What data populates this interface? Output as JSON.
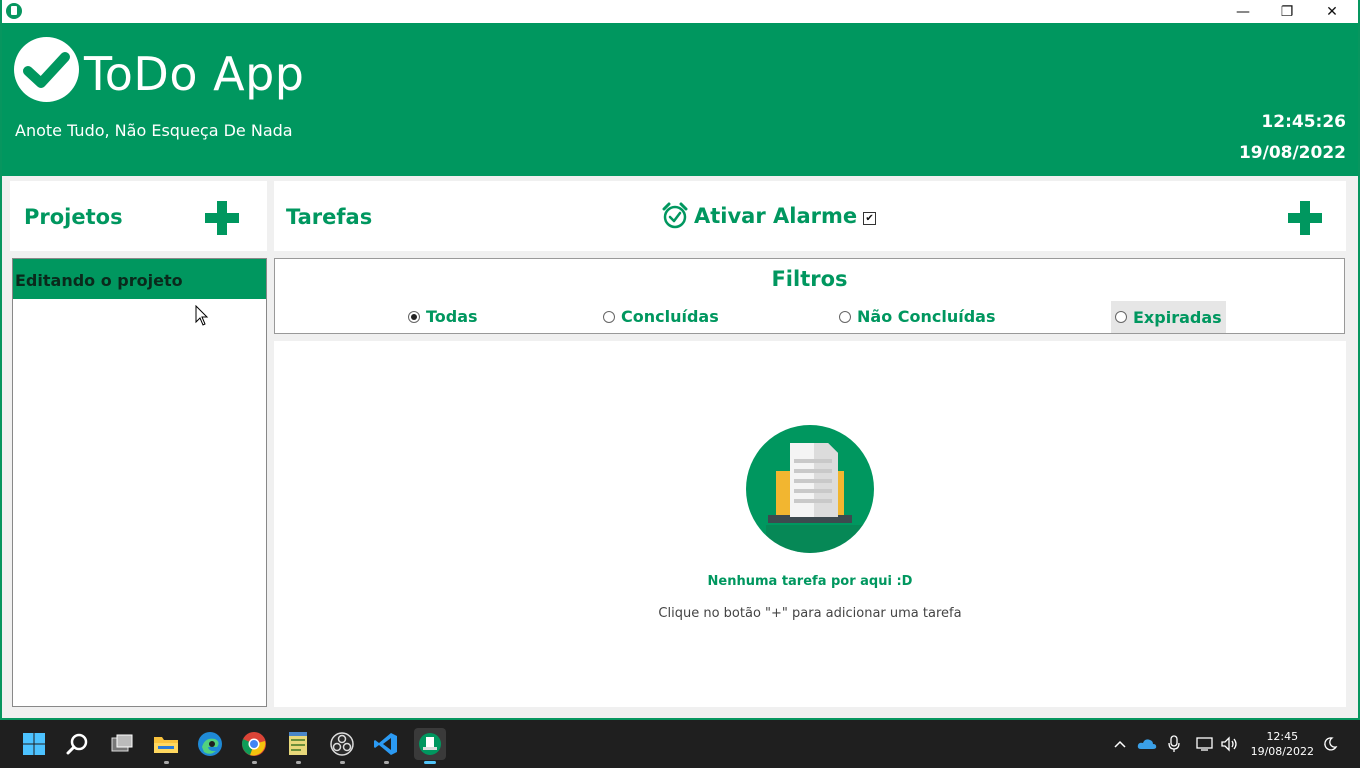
{
  "window": {
    "controls": {
      "minimize": "—",
      "maximize": "❐",
      "close": "✕"
    }
  },
  "header": {
    "title": "ToDo App",
    "subtitle": "Anote Tudo, Não Esqueça De Nada",
    "time": "12:45:26",
    "date": "19/08/2022"
  },
  "projects": {
    "title": "Projetos",
    "items": [
      {
        "label": "Editando o projeto"
      }
    ]
  },
  "tasks": {
    "title": "Tarefas",
    "alarm_label": "Ativar Alarme",
    "alarm_checked": true,
    "alarm_check_glyph": "✔"
  },
  "filters": {
    "title": "Filtros",
    "options": [
      {
        "label": "Todas",
        "selected": true
      },
      {
        "label": "Concluídas",
        "selected": false
      },
      {
        "label": "Não Concluídas",
        "selected": false
      },
      {
        "label": "Expiradas",
        "selected": false
      }
    ]
  },
  "empty_state": {
    "title": "Nenhuma tarefa por aqui :D",
    "subtitle": "Clique no botão \"+\" para adicionar uma tarefa"
  },
  "taskbar": {
    "clock_time": "12:45",
    "clock_date": "19/08/2022"
  },
  "colors": {
    "accent": "#00975f",
    "taskbar": "#1f1f1f"
  }
}
